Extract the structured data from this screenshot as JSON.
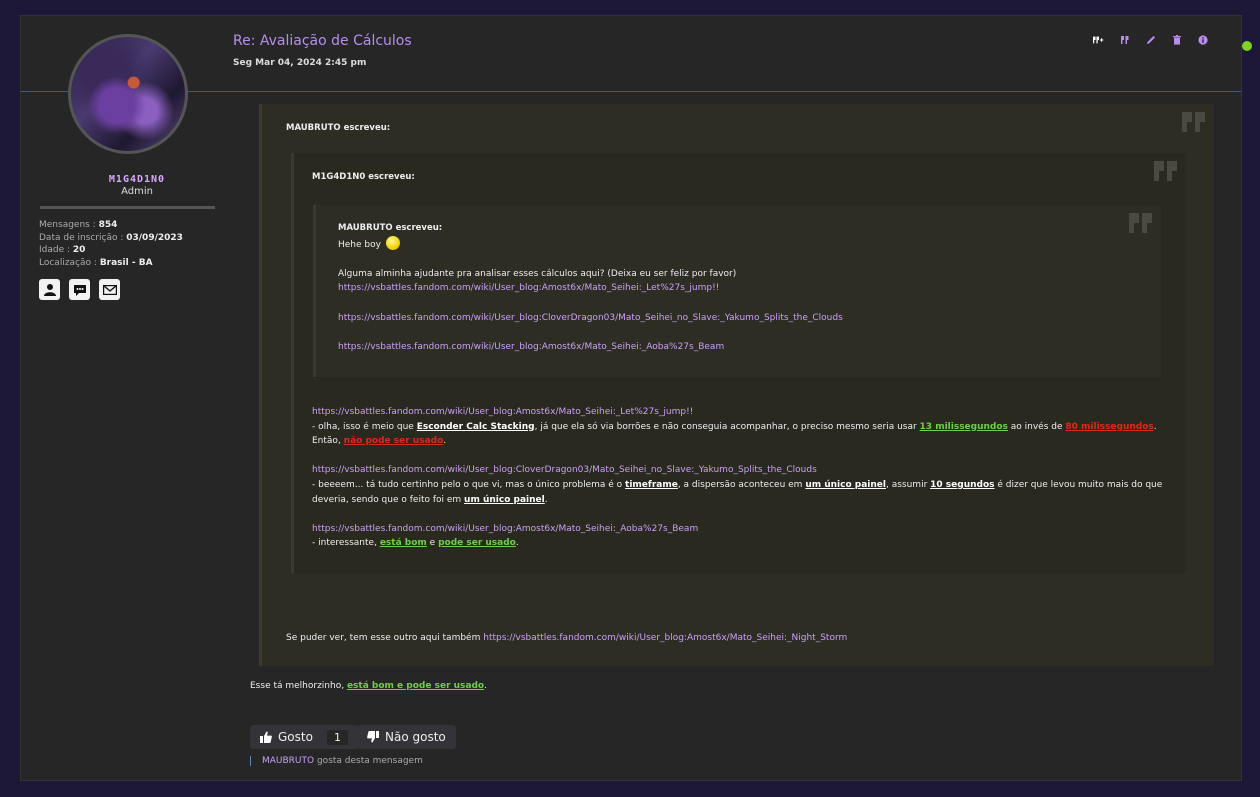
{
  "post": {
    "title": "Re: Avaliação de Cálculos",
    "date": "Seg Mar 04, 2024 2:45 pm"
  },
  "profile": {
    "username": "M1G4D1N0",
    "rank": "Admin",
    "stats": [
      {
        "label": "Mensagens",
        "value": "854"
      },
      {
        "label": "Data de inscrição",
        "value": "03/09/2023"
      },
      {
        "label": "Idade",
        "value": "20"
      },
      {
        "label": "Localização",
        "value": "Brasil - BA"
      }
    ]
  },
  "actions": [
    "quote-plus",
    "quote",
    "edit",
    "delete",
    "info"
  ],
  "quote1": {
    "author": "MAUBRUTO escreveu:",
    "closing_text": "Se puder ver, tem esse outro aqui também ",
    "closing_link": "https://vsbattles.fandom.com/wiki/User_blog:Amost6x/Mato_Seihei:_Night_Storm"
  },
  "quote2": {
    "author": "M1G4D1N0 escreveu:",
    "link1": "https://vsbattles.fandom.com/wiki/User_blog:Amost6x/Mato_Seihei:_Let%27s_jump!!",
    "c1_a": " - olha, isso é meio que ",
    "c1_b": "Esconder Calc Stacking",
    "c1_c": ", já que ela só via borrões e não conseguia acompanhar, o preciso mesmo seria usar ",
    "c1_d": "13 milissegundos",
    "c1_e": " ao invés de ",
    "c1_f": "80 milissegundos",
    "c1_g": ". Então, ",
    "c1_h": "não pode ser usado",
    "c1_i": ".",
    "link2": "https://vsbattles.fandom.com/wiki/User_blog:CloverDragon03/Mato_Seihei_no_Slave:_Yakumo_Splits_the_Clouds",
    "c2_a": " - beeeem... tá tudo certinho pelo o que vi, mas o único problema é o ",
    "c2_b": "timeframe",
    "c2_c": ", a dispersão aconteceu em ",
    "c2_d": "um único painel",
    "c2_e": ", assumir ",
    "c2_f": "10 segundos",
    "c2_g": " é dizer que levou muito mais do que deveria, sendo que o feito foi em ",
    "c2_h": "um único painel",
    "c2_i": ".",
    "link3": "https://vsbattles.fandom.com/wiki/User_blog:Amost6x/Mato_Seihei:_Aoba%27s_Beam",
    "c3_a": " - interessante, ",
    "c3_b": "está bom",
    "c3_c": " e ",
    "c3_d": "pode ser usado",
    "c3_e": "."
  },
  "quote3": {
    "author": "MAUBRUTO escreveu:",
    "greeting": "Hehe boy ",
    "request": "Alguma alminha ajudante pra analisar esses cálculos aqui? (Deixa eu ser feliz por favor)",
    "links": [
      "https://vsbattles.fandom.com/wiki/User_blog:Amost6x/Mato_Seihei:_Let%27s_jump!!",
      "https://vsbattles.fandom.com/wiki/User_blog:CloverDragon03/Mato_Seihei_no_Slave:_Yakumo_Splits_the_Clouds",
      "https://vsbattles.fandom.com/wiki/User_blog:Amost6x/Mato_Seihei:_Aoba%27s_Beam"
    ]
  },
  "reply": {
    "a": "Esse tá melhorzinho, ",
    "b": "está bom e pode ser usado",
    "c": "."
  },
  "likes": {
    "like_label": "Gosto",
    "like_count": "1",
    "dislike_label": "Não gosto",
    "liker": "MAUBRUTO",
    "liker_text": " gosta desta mensagem"
  },
  "colors": {
    "accent": "#b98cf0",
    "online": "#7ed321",
    "approve": "#6fcf4a",
    "reject": "#e0281c"
  }
}
